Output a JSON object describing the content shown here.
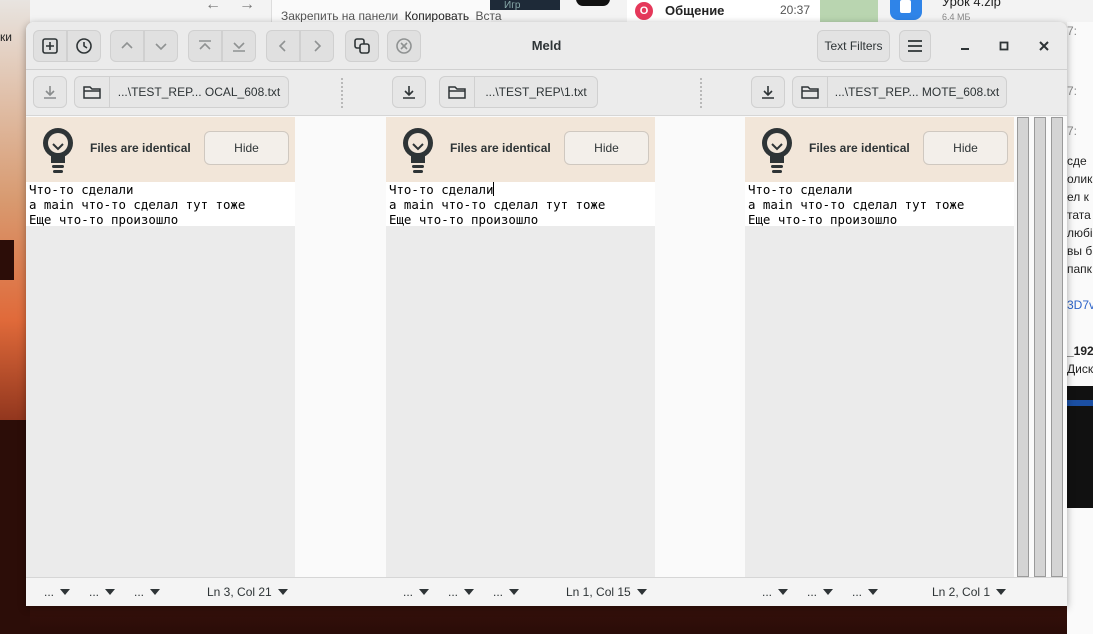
{
  "background": {
    "files_toolbar": {
      "pin_label": "Закрепить на панели",
      "copy_label": "Копировать",
      "paste_label": "Вста"
    },
    "notification": {
      "title": "Общение",
      "time": "20:37"
    },
    "download": {
      "name": "Урок 4.zip",
      "size": "6.4 МБ"
    },
    "left_fragment": "ки",
    "right_fragments": [
      "7:",
      "7:",
      "7:",
      "сде",
      "олик",
      "ел к",
      "тата",
      "любі",
      "вы б",
      "папк",
      "3D7v",
      "_192",
      "Диск"
    ]
  },
  "window": {
    "title": "Meld",
    "text_filters_label": "Text Filters"
  },
  "files": [
    {
      "path": "...\\TEST_REP... OCAL_608.txt"
    },
    {
      "path": "...\\TEST_REP\\1.txt"
    },
    {
      "path": "...\\TEST_REP... MOTE_608.txt"
    }
  ],
  "infobar": {
    "message": "Files are identical",
    "hide_label": "Hide"
  },
  "content_lines": [
    "Что-то сделали",
    "а main что-то сделал тут тоже",
    "Еще что-то произошло"
  ],
  "status": [
    {
      "dd1": "...",
      "dd2": "...",
      "dd3": "...",
      "position": "Ln 3, Col 21"
    },
    {
      "dd1": "...",
      "dd2": "...",
      "dd3": "...",
      "position": "Ln 1, Col 15"
    },
    {
      "dd1": "...",
      "dd2": "...",
      "dd3": "...",
      "position": "Ln 2, Col 1"
    }
  ]
}
